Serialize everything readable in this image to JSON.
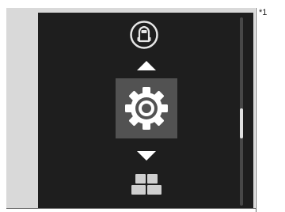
{
  "note": "*1",
  "menu": {
    "previous_item": {
      "icon": "car-icon"
    },
    "selected_item": {
      "icon": "gear-icon"
    },
    "next_item": {
      "icon": "apps-icon"
    },
    "up_arrow": {
      "icon": "triangle-up-icon"
    },
    "down_arrow": {
      "icon": "triangle-down-icon"
    }
  },
  "scrollbar": {
    "position_fraction": 0.49,
    "thumb_fraction": 0.16
  },
  "colors": {
    "screen_background": "#1e1e1e",
    "selected_tile": "#525252",
    "icon_foreground": "#ffffff",
    "scroll_track": "#484848",
    "scroll_thumb": "#e0e0e0"
  }
}
